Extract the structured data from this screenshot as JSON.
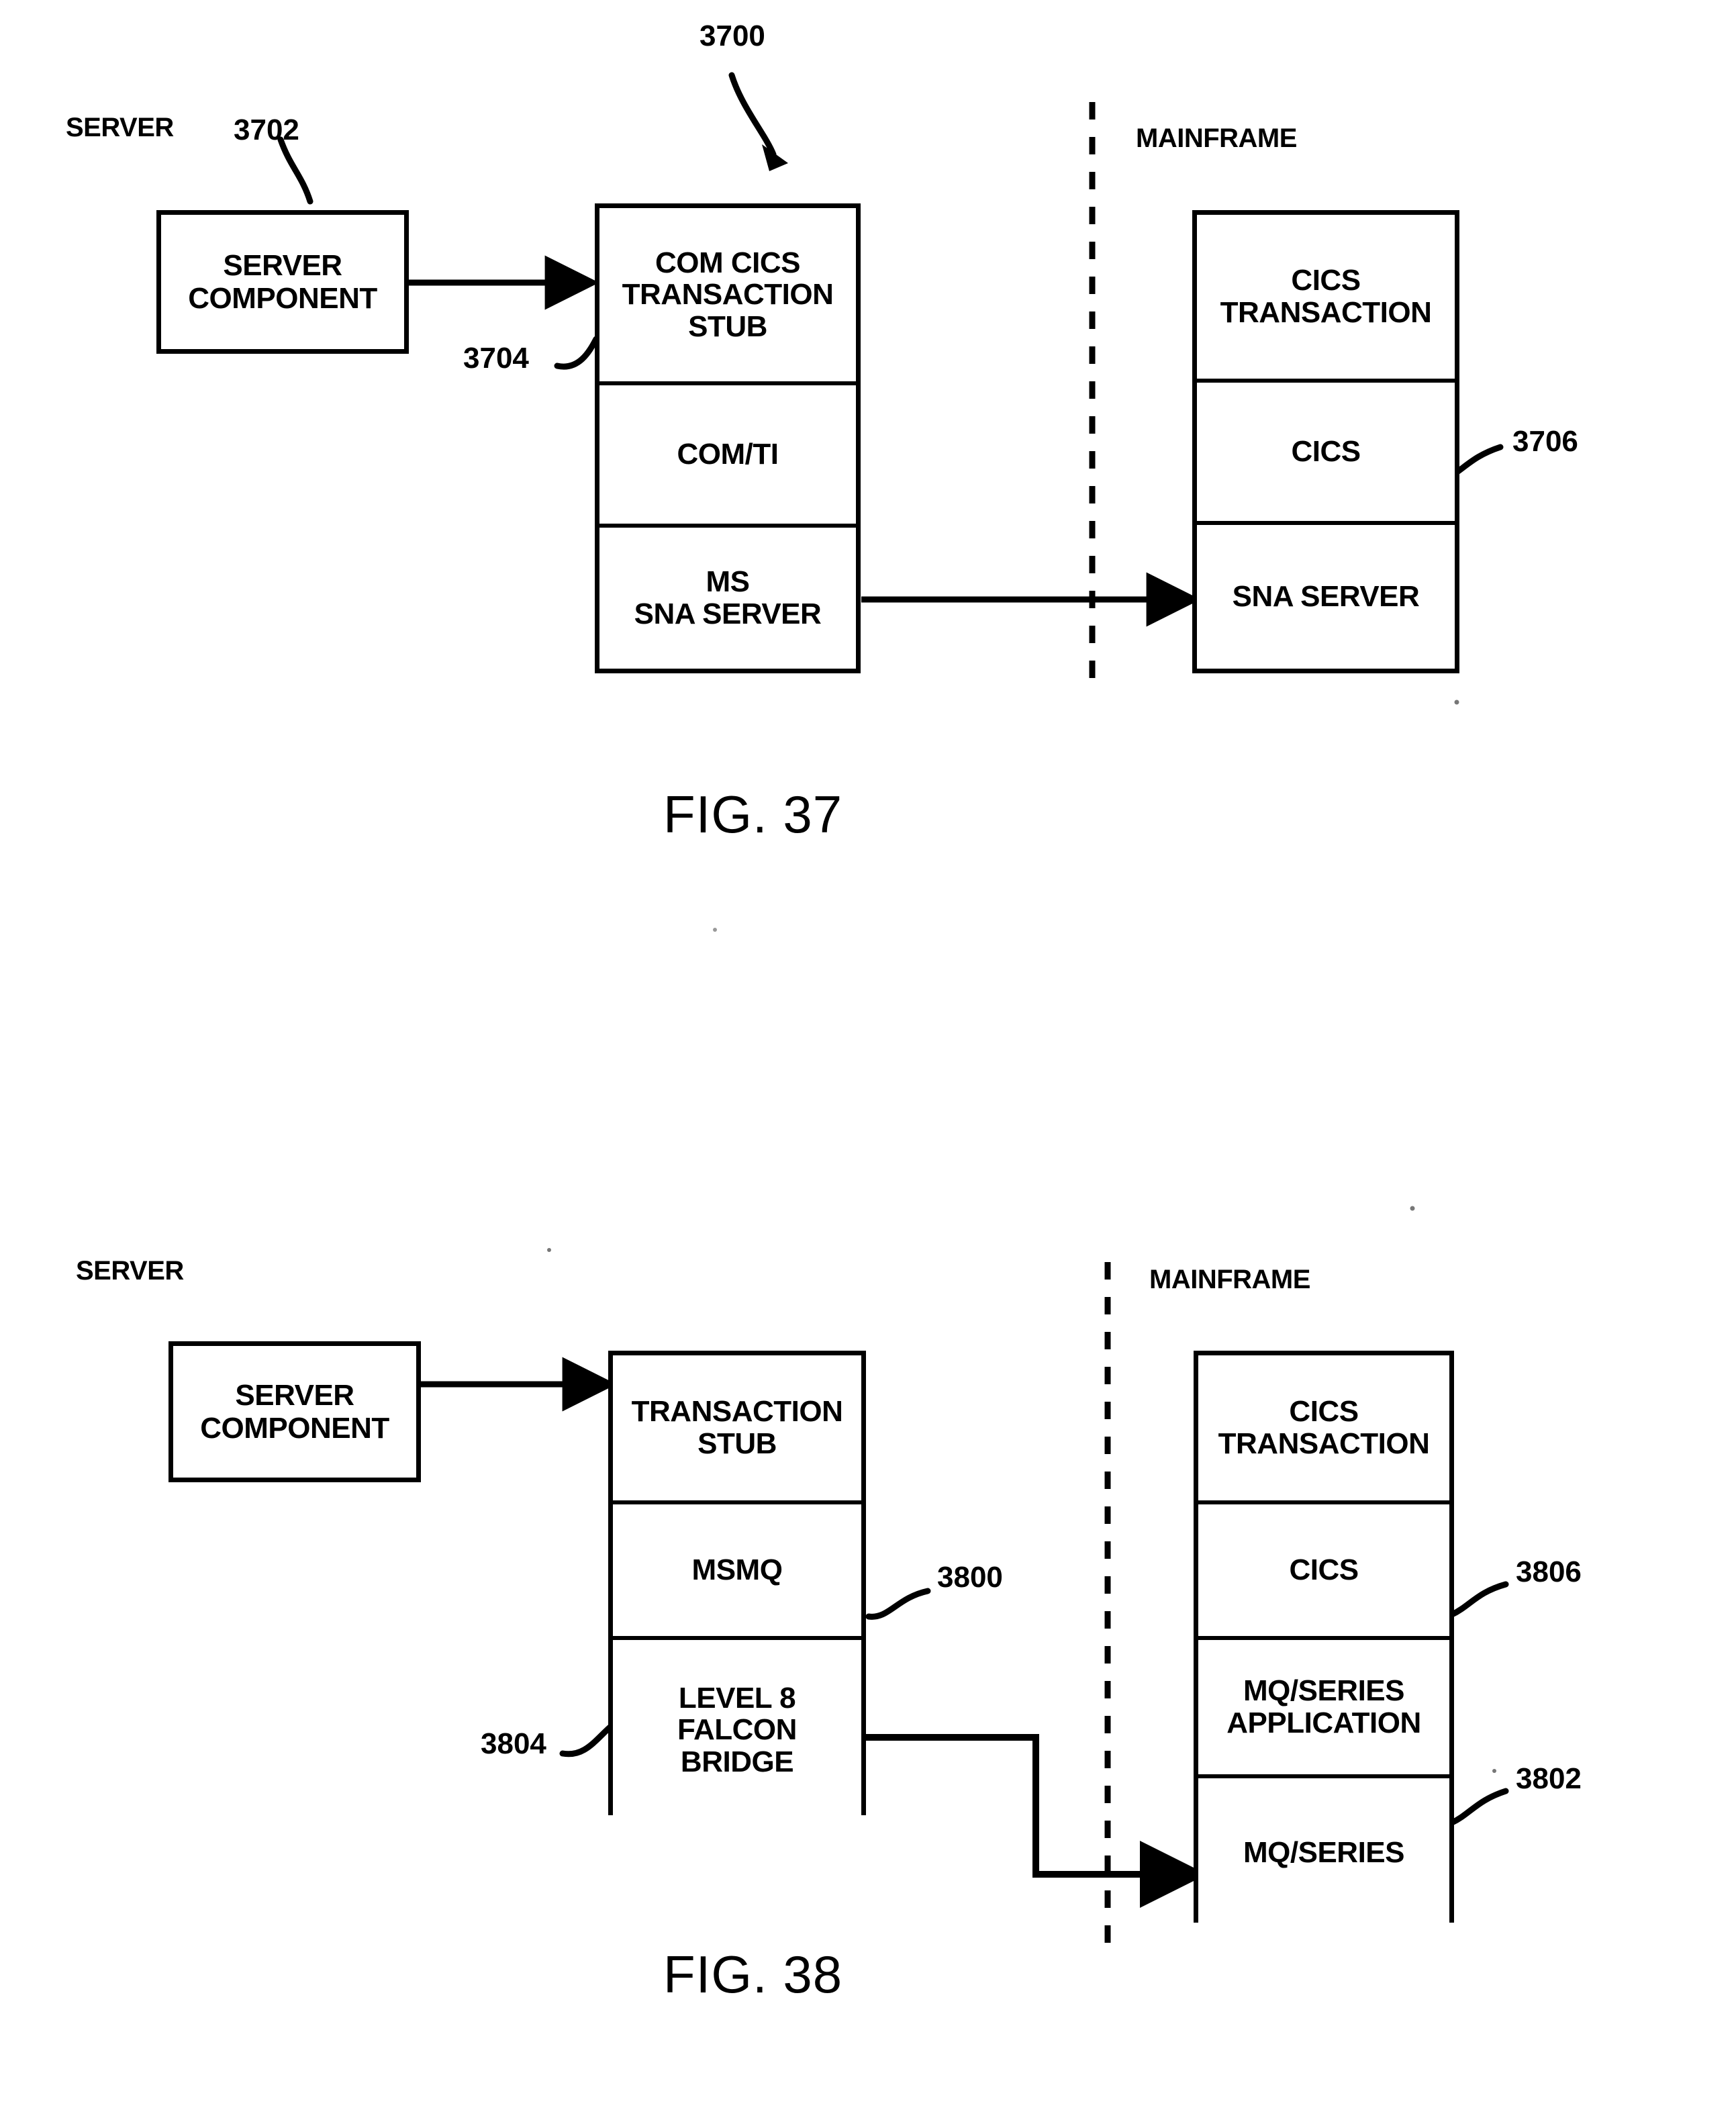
{
  "figures": [
    {
      "id": "fig37",
      "caption": "FIG. 37",
      "side_labels": {
        "left": "SERVER",
        "right": "MAINFRAME"
      },
      "callouts": {
        "main": "3700",
        "server_component": "3702",
        "stub": "3704",
        "mainframe_stack": "3706"
      },
      "server_component_box": "SERVER\nCOMPONENT",
      "server_stack": [
        "COM CICS\nTRANSACTION\nSTUB",
        "COM/TI",
        "MS\nSNA SERVER"
      ],
      "mainframe_stack": [
        "CICS\nTRANSACTION",
        "CICS",
        "SNA SERVER"
      ]
    },
    {
      "id": "fig38",
      "caption": "FIG. 38",
      "side_labels": {
        "left": "SERVER",
        "right": "MAINFRAME"
      },
      "callouts": {
        "msmq": "3800",
        "mqseries": "3802",
        "falcon_bridge": "3804",
        "cics": "3806"
      },
      "server_component_box": "SERVER\nCOMPONENT",
      "server_stack": [
        "TRANSACTION\nSTUB",
        "MSMQ",
        "LEVEL 8\nFALCON\nBRIDGE"
      ],
      "mainframe_stack": [
        "CICS\nTRANSACTION",
        "CICS",
        "MQ/SERIES\nAPPLICATION",
        "MQ/SERIES"
      ]
    }
  ]
}
